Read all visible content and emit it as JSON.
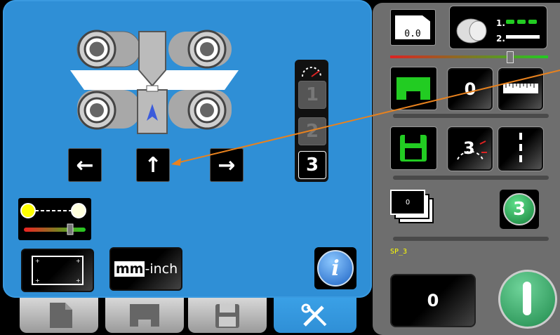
{
  "feed": {
    "steps": [
      "1",
      "2",
      "3"
    ],
    "active_step": 3
  },
  "icons": {
    "left": "←",
    "up": "↑",
    "right": "→"
  },
  "units_button": {
    "mm": "mm",
    "sep": "-",
    "inch": "inch"
  },
  "info_icon": "i",
  "right": {
    "counter_value": "0.0",
    "zero_value": "0",
    "step_badge": "3",
    "stack_label": "0",
    "step_circle": "3",
    "program_name": "SP_3",
    "bottom_value": "0",
    "slider_level_pct": 73
  },
  "colors": {
    "panel_blue": "#2f8fd6",
    "accent_green": "#22cc22",
    "start_green": "#2fa85a",
    "annotation_orange": "#e8821e"
  },
  "tabs": [
    {
      "id": "document",
      "icon": "document-icon",
      "active": false
    },
    {
      "id": "profile",
      "icon": "profile-icon",
      "active": false
    },
    {
      "id": "save",
      "icon": "floppy-icon",
      "active": false
    },
    {
      "id": "tools",
      "icon": "tools-icon",
      "active": true
    }
  ]
}
